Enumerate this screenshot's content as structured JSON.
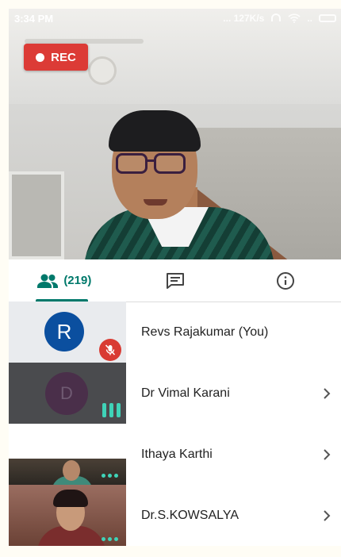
{
  "status_bar": {
    "time": "3:34 PM",
    "network_speed": "... 127K/s"
  },
  "recording": {
    "label": "REC"
  },
  "tabs": [
    {
      "id": "people",
      "count": "(219)",
      "icon": "people-icon",
      "selected": true
    },
    {
      "id": "chat",
      "icon": "chat-icon"
    },
    {
      "id": "info",
      "icon": "info-icon"
    }
  ],
  "participants": [
    {
      "name": "Revs Rajakumar (You)",
      "avatar_letter": "R",
      "muted": true
    },
    {
      "name": "Dr Vimal Karani",
      "avatar_letter": "D",
      "speaking": true
    },
    {
      "name": "Ithaya Karthi"
    },
    {
      "name": "Dr.S.KOWSALYA"
    }
  ],
  "colors": {
    "accent": "#00796b",
    "rec_red": "#dc3b36",
    "avatar_blue": "#0b4f9f",
    "audio_indicator": "#3fd3b8"
  }
}
